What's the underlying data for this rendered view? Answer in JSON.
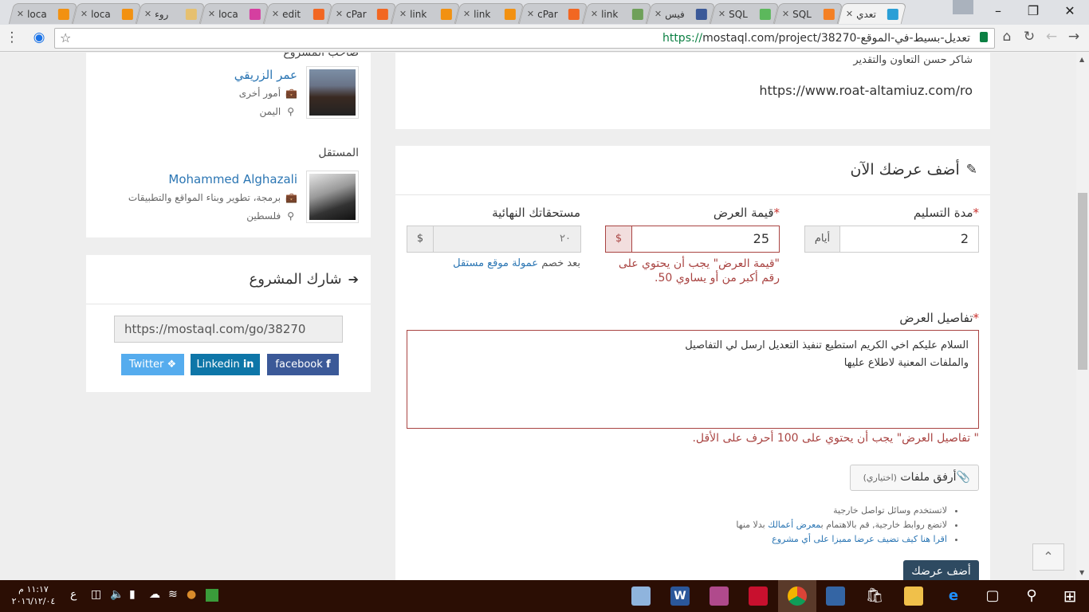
{
  "browser": {
    "tabs": [
      {
        "label": "loca",
        "fav_color": "#f29111"
      },
      {
        "label": "loca",
        "fav_color": "#f29111"
      },
      {
        "label": "روء",
        "fav_color": "#e6c070"
      },
      {
        "label": "loca",
        "fav_color": "#d53fa0"
      },
      {
        "label": "edit",
        "fav_color": "#f26722"
      },
      {
        "label": "cPar",
        "fav_color": "#f26722"
      },
      {
        "label": "link",
        "fav_color": "#f29111"
      },
      {
        "label": "link",
        "fav_color": "#f29111"
      },
      {
        "label": "cPar",
        "fav_color": "#f26722"
      },
      {
        "label": "link",
        "fav_color": "#6fa05a"
      },
      {
        "label": "فيس",
        "fav_color": "#3b5998"
      },
      {
        "label": "SQL",
        "fav_color": "#5cb85c"
      },
      {
        "label": "SQL",
        "fav_color": "#f48024"
      },
      {
        "label": "تعدي",
        "fav_color": "#2a9fd6"
      }
    ],
    "url_scheme": "https://",
    "url_rest": "mostaql.com/project/38270-تعديل-بسيط-في-الموقع"
  },
  "sidebar": {
    "owner_heading": "صاحب المشروع",
    "owner": {
      "name": "عمر الزريقي",
      "category": "أمور أخرى",
      "country": "اليمن"
    },
    "freelancer_heading": "المستقل",
    "freelancer": {
      "name": "Mohammed Alghazali",
      "category": "برمجة، تطوير وبناء المواقع والتطبيقات",
      "country": "فلسطين"
    },
    "share": {
      "title": "شارك المشروع",
      "url": "https://mostaql.com/go/38270",
      "buttons": {
        "twitter": "Twitter",
        "linkedin": "Linkedin",
        "facebook": "facebook"
      }
    }
  },
  "project": {
    "thanks_line": "شاكر حسن التعاون والتقدير",
    "site_url": "https://www.roat-altamiuz.com/ro"
  },
  "bid": {
    "title": "أضف عرضك الآن",
    "delivery": {
      "label": "مدة التسليم",
      "value": "2",
      "unit": "أيام"
    },
    "price": {
      "label": "قيمة العرض",
      "value": "25",
      "currency": "$",
      "error": "\"قيمة العرض\" يجب أن يحتوي على رقم أكبر من أو يساوي 50."
    },
    "earnings": {
      "label": "مستحقاتك النهائية",
      "value": "٢٠",
      "currency": "$",
      "note_prefix": "بعد خصم",
      "note_link": "عمولة موقع مستقل"
    },
    "details": {
      "label": "تفاصيل العرض",
      "line1": "السلام عليكم اخي الكريم استطيع تنفيذ التعديل ارسل لي التفاصيل",
      "line2": "والملفات المعنية لاطلاع عليها",
      "error": "\" تفاصيل العرض\" يجب أن يحتوي على 100 أحرف على الأقل."
    },
    "attach": {
      "label": "أرفق ملفات",
      "optional": "(اختياري)"
    },
    "tips": {
      "tip1": "لاتستخدم وسائل تواصل خارجية",
      "tip2_prefix": "لاتضع روابط خارجية, قم بالاهتمام ب",
      "tip2_link": "معرض أعمالك",
      "tip2_suffix": " بدلا منها",
      "tip3": "اقرا هنا كيف تضيف عرضا مميزا على أي مشروع"
    },
    "submit": "أضف عرضك"
  },
  "taskbar": {
    "time": "١١:١٧ م",
    "date": "٢٠١٦/١٢/٠٤",
    "lang": "ع"
  }
}
